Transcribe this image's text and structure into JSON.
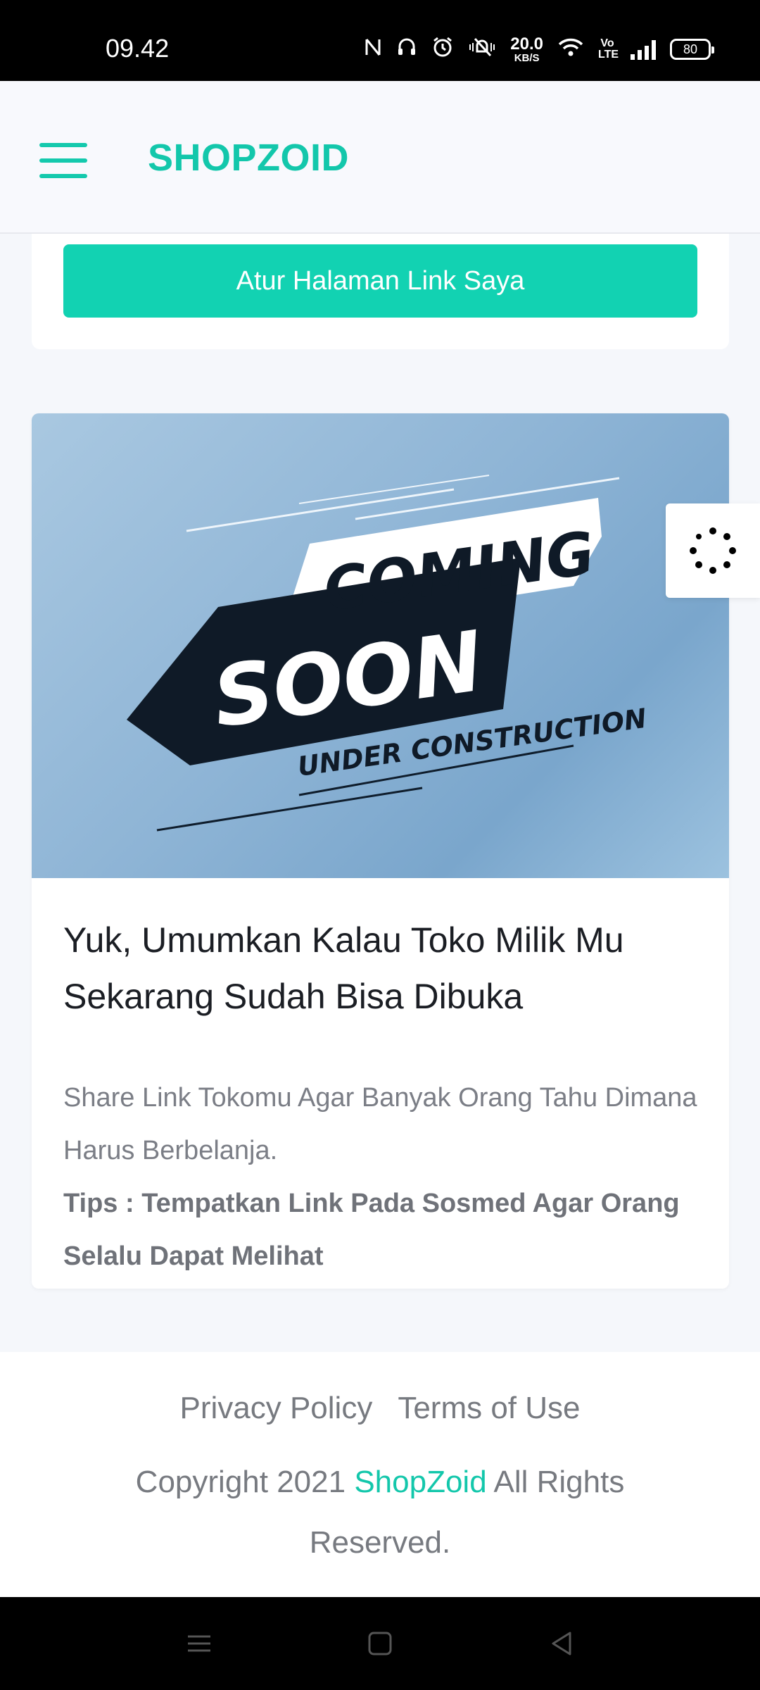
{
  "status_bar": {
    "time": "09.42",
    "net_speed_value": "20.0",
    "net_speed_unit": "KB/S",
    "volte": "Vo LTE",
    "battery": "80"
  },
  "header": {
    "brand": "SHOPZOID"
  },
  "top_card": {
    "button_label": "Atur Halaman Link Saya"
  },
  "promo_card": {
    "image_text": {
      "line1": "COMING",
      "line2": "SOON",
      "line3": "UNDER CONSTRUCTION"
    },
    "title": "Yuk, Umumkan Kalau Toko Milik Mu Sekarang Sudah Bisa Dibuka",
    "description": "Share Link Tokomu Agar Banyak Orang Tahu Dimana Harus Berbelanja.",
    "tips": "Tips : Tempatkan Link Pada Sosmed Agar Orang Selalu Dapat Melihat"
  },
  "footer": {
    "privacy": "Privacy Policy",
    "terms": "Terms of Use",
    "copyright_prefix": "Copyright 2021",
    "brand_link": "ShopZoid",
    "copyright_suffix": "All Rights Reserved."
  },
  "colors": {
    "accent": "#13c7ab",
    "button": "#12d2b2"
  },
  "icons": [
    "nfc-icon",
    "headset-icon",
    "alarm-icon",
    "vibrate-icon",
    "wifi-icon",
    "signal-icon",
    "battery-icon",
    "menu-icon",
    "loading-spinner-icon",
    "nav-menu-icon",
    "nav-home-icon",
    "nav-back-icon"
  ]
}
